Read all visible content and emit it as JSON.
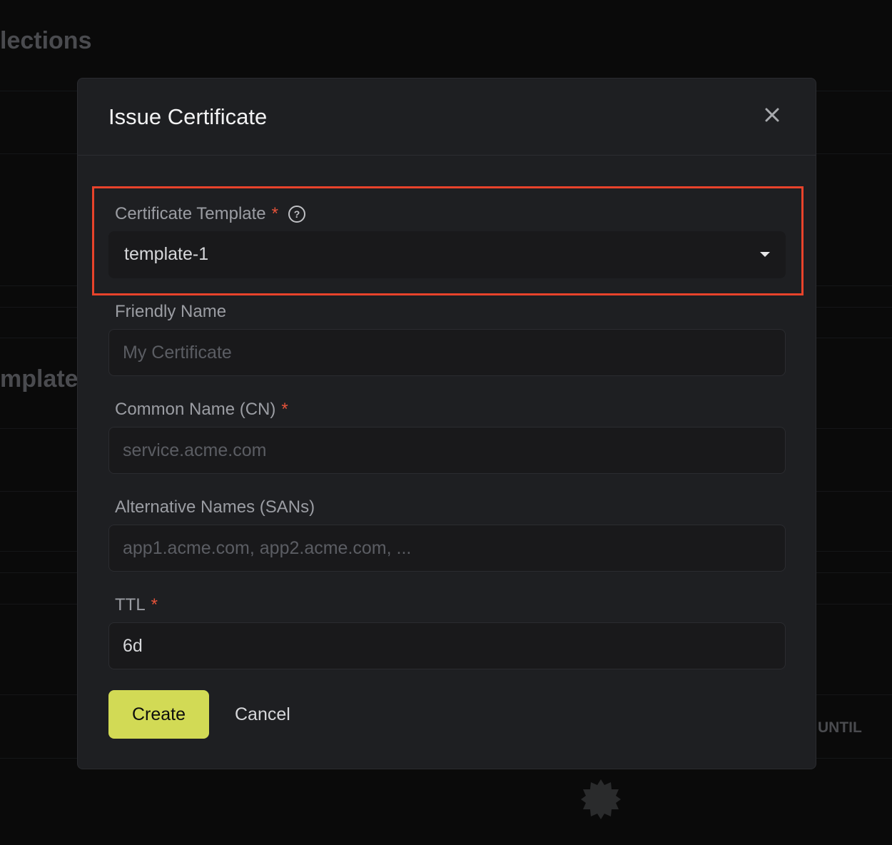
{
  "background": {
    "heading_1": "lections",
    "heading_2": "mplates",
    "column_header": "UNTIL",
    "loading_icon": "spinner-badge-icon"
  },
  "modal": {
    "title": "Issue Certificate",
    "close_icon": "close-icon",
    "fields": [
      {
        "label": "Certificate Template",
        "required": "*",
        "value": "template-1",
        "type": "select",
        "help_icon": "?"
      },
      {
        "label": "Friendly Name",
        "placeholder": "My Certificate"
      },
      {
        "label": "Common Name (CN)",
        "required": "*",
        "placeholder": "service.acme.com"
      },
      {
        "label": "Alternative Names (SANs)",
        "placeholder": "app1.acme.com, app2.acme.com, ..."
      },
      {
        "label": "TTL",
        "required": "*",
        "value": "6d"
      }
    ],
    "create_label": "Create",
    "cancel_label": "Cancel"
  },
  "colors": {
    "accent": "#d2da55",
    "highlight": "#e8432b",
    "required": "#e5533a"
  }
}
